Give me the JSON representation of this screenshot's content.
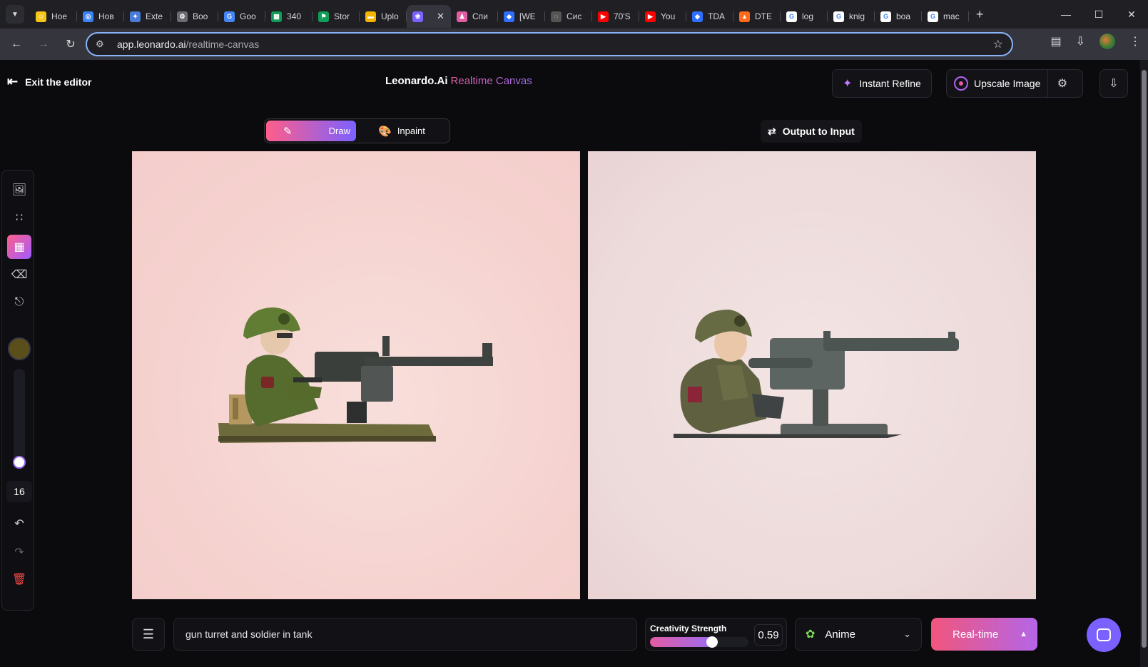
{
  "browser": {
    "tabs": [
      {
        "label": "Hoе",
        "color": "#f5c518",
        "glyph": "☺"
      },
      {
        "label": "Hoв",
        "color": "#3b82f6",
        "glyph": "◎"
      },
      {
        "label": "Exte",
        "color": "#4a7bd8",
        "glyph": "✦"
      },
      {
        "label": "Boo",
        "color": "#6b6b75",
        "glyph": "⚙"
      },
      {
        "label": "Goo",
        "color": "#4285f4",
        "glyph": "G"
      },
      {
        "label": "340",
        "color": "#0f9d58",
        "glyph": "▦"
      },
      {
        "label": "Stor",
        "color": "#0f9d58",
        "glyph": "⚑"
      },
      {
        "label": "Uplo",
        "color": "#f4b400",
        "glyph": "▬"
      },
      {
        "label": "",
        "color": "#7b61ff",
        "glyph": "❀",
        "active": true
      },
      {
        "label": "Спи",
        "color": "#e35ba3",
        "glyph": "♟"
      },
      {
        "label": "[WE",
        "color": "#2f6fff",
        "glyph": "◆"
      },
      {
        "label": "Сис",
        "color": "#555",
        "glyph": "◌"
      },
      {
        "label": "70'S",
        "color": "#ff0000",
        "glyph": "▶"
      },
      {
        "label": "You",
        "color": "#ff0000",
        "glyph": "▶"
      },
      {
        "label": "TDA",
        "color": "#2f6fff",
        "glyph": "◆"
      },
      {
        "label": "DTE",
        "color": "#ff6a1a",
        "glyph": "▲"
      },
      {
        "label": "log",
        "color": "#ffffff",
        "glyph": "G"
      },
      {
        "label": "knig",
        "color": "#ffffff",
        "glyph": "G"
      },
      {
        "label": "boa",
        "color": "#ffffff",
        "glyph": "G"
      },
      {
        "label": "mac",
        "color": "#ffffff",
        "glyph": "G"
      }
    ],
    "url_host": "app.leonardo.ai",
    "url_path": "/realtime-canvas"
  },
  "header": {
    "exit_label": "Exit the editor",
    "brand": "Leonardo.Ai",
    "product": "Realtime Canvas",
    "instant_refine": "Instant Refine",
    "upscale_image": "Upscale Image"
  },
  "modes": {
    "draw": "Draw",
    "inpaint": "Inpaint",
    "output_to_input": "Output to Input"
  },
  "toolbar": {
    "brush_size": "16",
    "brush_color": "#5a4f1a"
  },
  "bottom": {
    "prompt_value": "gun turret and soldier in tank",
    "creativity_label": "Creativity Strength",
    "creativity_value": "0.59",
    "creativity_fraction": 0.59,
    "style": "Anime",
    "realtime_label": "Real-time"
  }
}
